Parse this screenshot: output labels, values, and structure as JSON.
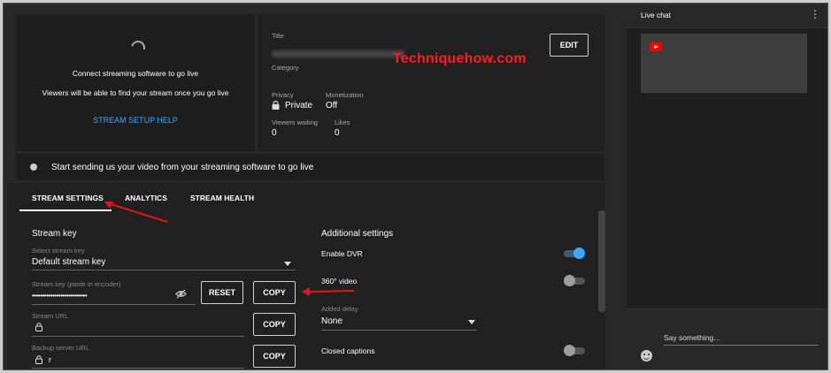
{
  "preview": {
    "connect_text": "Connect streaming software to go live",
    "viewers_text": "Viewers will be able to find your stream once you go live",
    "setup_help": "STREAM SETUP HELP"
  },
  "info": {
    "title_label": "Title",
    "category_label": "Category",
    "privacy_label": "Privacy",
    "privacy_value": "Private",
    "monetization_label": "Monetization",
    "monetization_value": "Off",
    "viewers_waiting_label": "Viewers waiting",
    "viewers_waiting_value": "0",
    "likes_label": "Likes",
    "likes_value": "0",
    "edit_label": "EDIT"
  },
  "watermark": "Techniquehow.com",
  "status": {
    "message": "Start sending us your video from your streaming software to go live"
  },
  "tabs": [
    {
      "label": "STREAM SETTINGS",
      "active": true
    },
    {
      "label": "ANALYTICS",
      "active": false
    },
    {
      "label": "STREAM HEALTH",
      "active": false
    }
  ],
  "stream_key": {
    "section_title": "Stream key",
    "select_label": "Select stream key",
    "select_value": "Default stream key",
    "key_label": "Stream key (paste in encoder)",
    "key_value": "•••••••••••••••••••••••••••",
    "reset_label": "RESET",
    "copy_label": "COPY",
    "url_label": "Stream URL",
    "backup_label": "Backup server URL",
    "backup_value": "r"
  },
  "additional": {
    "section_title": "Additional settings",
    "enable_dvr_label": "Enable DVR",
    "enable_dvr_on": true,
    "video360_label": "360° video",
    "video360_on": false,
    "added_delay_label": "Added delay",
    "added_delay_value": "None",
    "closed_captions_label": "Closed captions",
    "closed_captions_on": false
  },
  "chat": {
    "title": "Live chat",
    "placeholder": "Say something..."
  },
  "colors": {
    "accent_blue": "#3ea6ff",
    "annotation_red": "#e8141c",
    "background": "#282828"
  }
}
